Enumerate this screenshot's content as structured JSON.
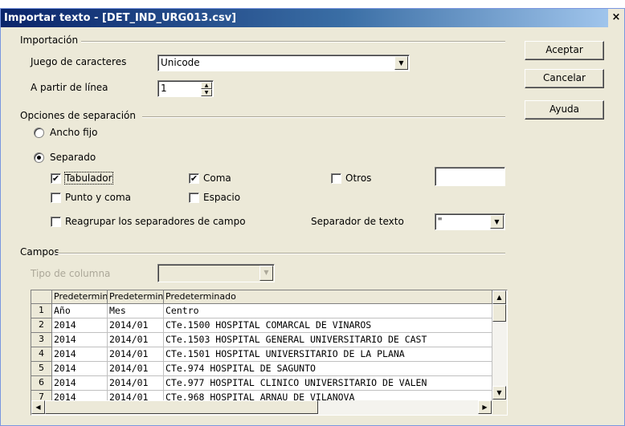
{
  "window": {
    "title": "Importar texto - [DET_IND_URG013.csv]",
    "close_glyph": "×"
  },
  "import_group": {
    "label": "Importación",
    "charset_label": "Juego de caracteres",
    "charset_value": "Unicode",
    "from_line_label": "A partir de línea",
    "from_line_value": "1"
  },
  "separator_group": {
    "label": "Opciones de separación",
    "fixed_width": {
      "label": "Ancho fijo",
      "selected": false
    },
    "separated": {
      "label": "Separado",
      "selected": true
    },
    "tab": {
      "label": "Tabulador",
      "checked": true
    },
    "comma": {
      "label": "Coma",
      "checked": true
    },
    "other": {
      "label": "Otros",
      "checked": false,
      "value": ""
    },
    "semicolon": {
      "label": "Punto y coma",
      "checked": false
    },
    "space": {
      "label": "Espacio",
      "checked": false
    },
    "merge": {
      "label": "Reagrupar los separadores de campo",
      "checked": false
    },
    "text_delimiter_label": "Separador de texto",
    "text_delimiter_value": "\""
  },
  "fields_group": {
    "label": "Campos",
    "column_type_label": "Tipo de columna",
    "column_type_value": ""
  },
  "buttons": {
    "ok": "Aceptar",
    "cancel": "Cancelar",
    "help": "Ayuda"
  },
  "check_mark": "✔",
  "grid": {
    "headers": [
      "Predeterminado",
      "Predeterminado",
      "Predeterminado"
    ],
    "rows": [
      {
        "num": "1",
        "cells": [
          "Año",
          "Mes",
          "Centro"
        ]
      },
      {
        "num": "2",
        "cells": [
          "2014",
          "2014/01",
          "CTe.1500 HOSPITAL COMARCAL DE VINAROS"
        ]
      },
      {
        "num": "3",
        "cells": [
          "2014",
          "2014/01",
          "CTe.1503 HOSPITAL GENERAL UNIVERSITARIO DE CAST"
        ]
      },
      {
        "num": "4",
        "cells": [
          "2014",
          "2014/01",
          "CTe.1501 HOSPITAL UNIVERSITARIO DE LA PLANA"
        ]
      },
      {
        "num": "5",
        "cells": [
          "2014",
          "2014/01",
          "CTe.974 HOSPITAL DE SAGUNTO"
        ]
      },
      {
        "num": "6",
        "cells": [
          "2014",
          "2014/01",
          "CTe.977 HOSPITAL CLINICO UNIVERSITARIO DE VALEN"
        ]
      },
      {
        "num": "7",
        "cells": [
          "2014",
          "2014/01",
          "CTe.968 HOSPITAL ARNAU DE VILANOVA"
        ]
      }
    ]
  },
  "colors": {
    "dialog_bg": "#ece9d8",
    "title_gradient_start": "#0a246a",
    "title_gradient_end": "#a6caf0"
  }
}
